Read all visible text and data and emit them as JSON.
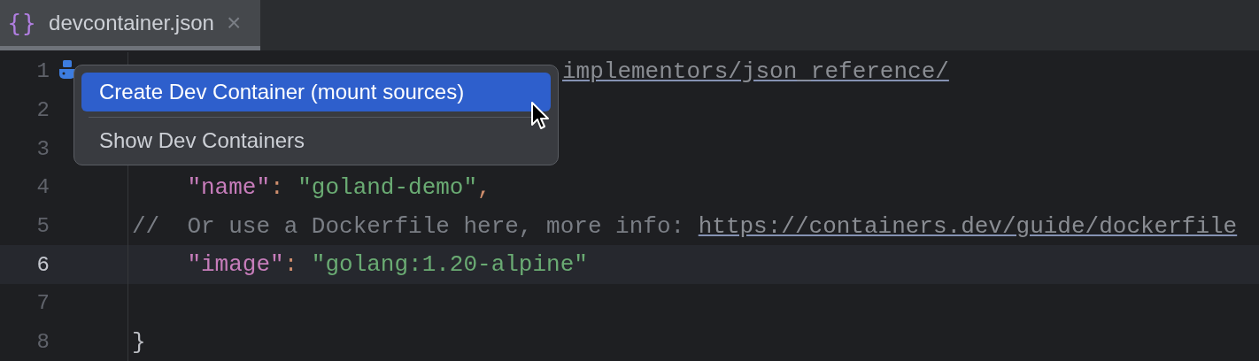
{
  "tab": {
    "icon": "{}",
    "label": "devcontainer.json",
    "close": "×",
    "selected": true
  },
  "lines": [
    {
      "number": "1",
      "current": false,
      "kind": "top",
      "tokens": [
        {
          "kind": "link",
          "text": "implementors/json_reference/"
        }
      ]
    },
    {
      "number": "2",
      "current": false,
      "kind": "top"
    },
    {
      "number": "3",
      "current": false,
      "kind": "top"
    },
    {
      "number": "4",
      "current": false,
      "kind": "member",
      "tokens": [
        {
          "kind": "key",
          "text": "\"name\""
        },
        {
          "kind": "punct",
          "text": ":"
        },
        {
          "kind": "string",
          "text": "\"goland-demo\""
        },
        {
          "kind": "punct",
          "text": ","
        }
      ]
    },
    {
      "number": "5",
      "current": false,
      "kind": "top",
      "tokens": [
        {
          "kind": "comment",
          "text": "//  Or use a Dockerfile here, more info:"
        },
        {
          "kind": "link",
          "text": "https://containers.dev/guide/dockerfile"
        }
      ]
    },
    {
      "number": "6",
      "current": true,
      "kind": "member",
      "tokens": [
        {
          "kind": "key",
          "text": "\"image\""
        },
        {
          "kind": "punct",
          "text": ":"
        },
        {
          "kind": "string",
          "text": "\"golang:1.20-alpine\""
        }
      ]
    },
    {
      "number": "7",
      "current": false,
      "kind": "top"
    },
    {
      "number": "8",
      "current": false,
      "kind": "top",
      "tokens": [
        {
          "kind": "brace",
          "text": "}"
        }
      ]
    }
  ],
  "popup": {
    "items": [
      {
        "label": "Create Dev Container (mount sources)",
        "selected": true
      },
      {
        "label": "Show Dev Containers",
        "selected": false
      }
    ]
  }
}
